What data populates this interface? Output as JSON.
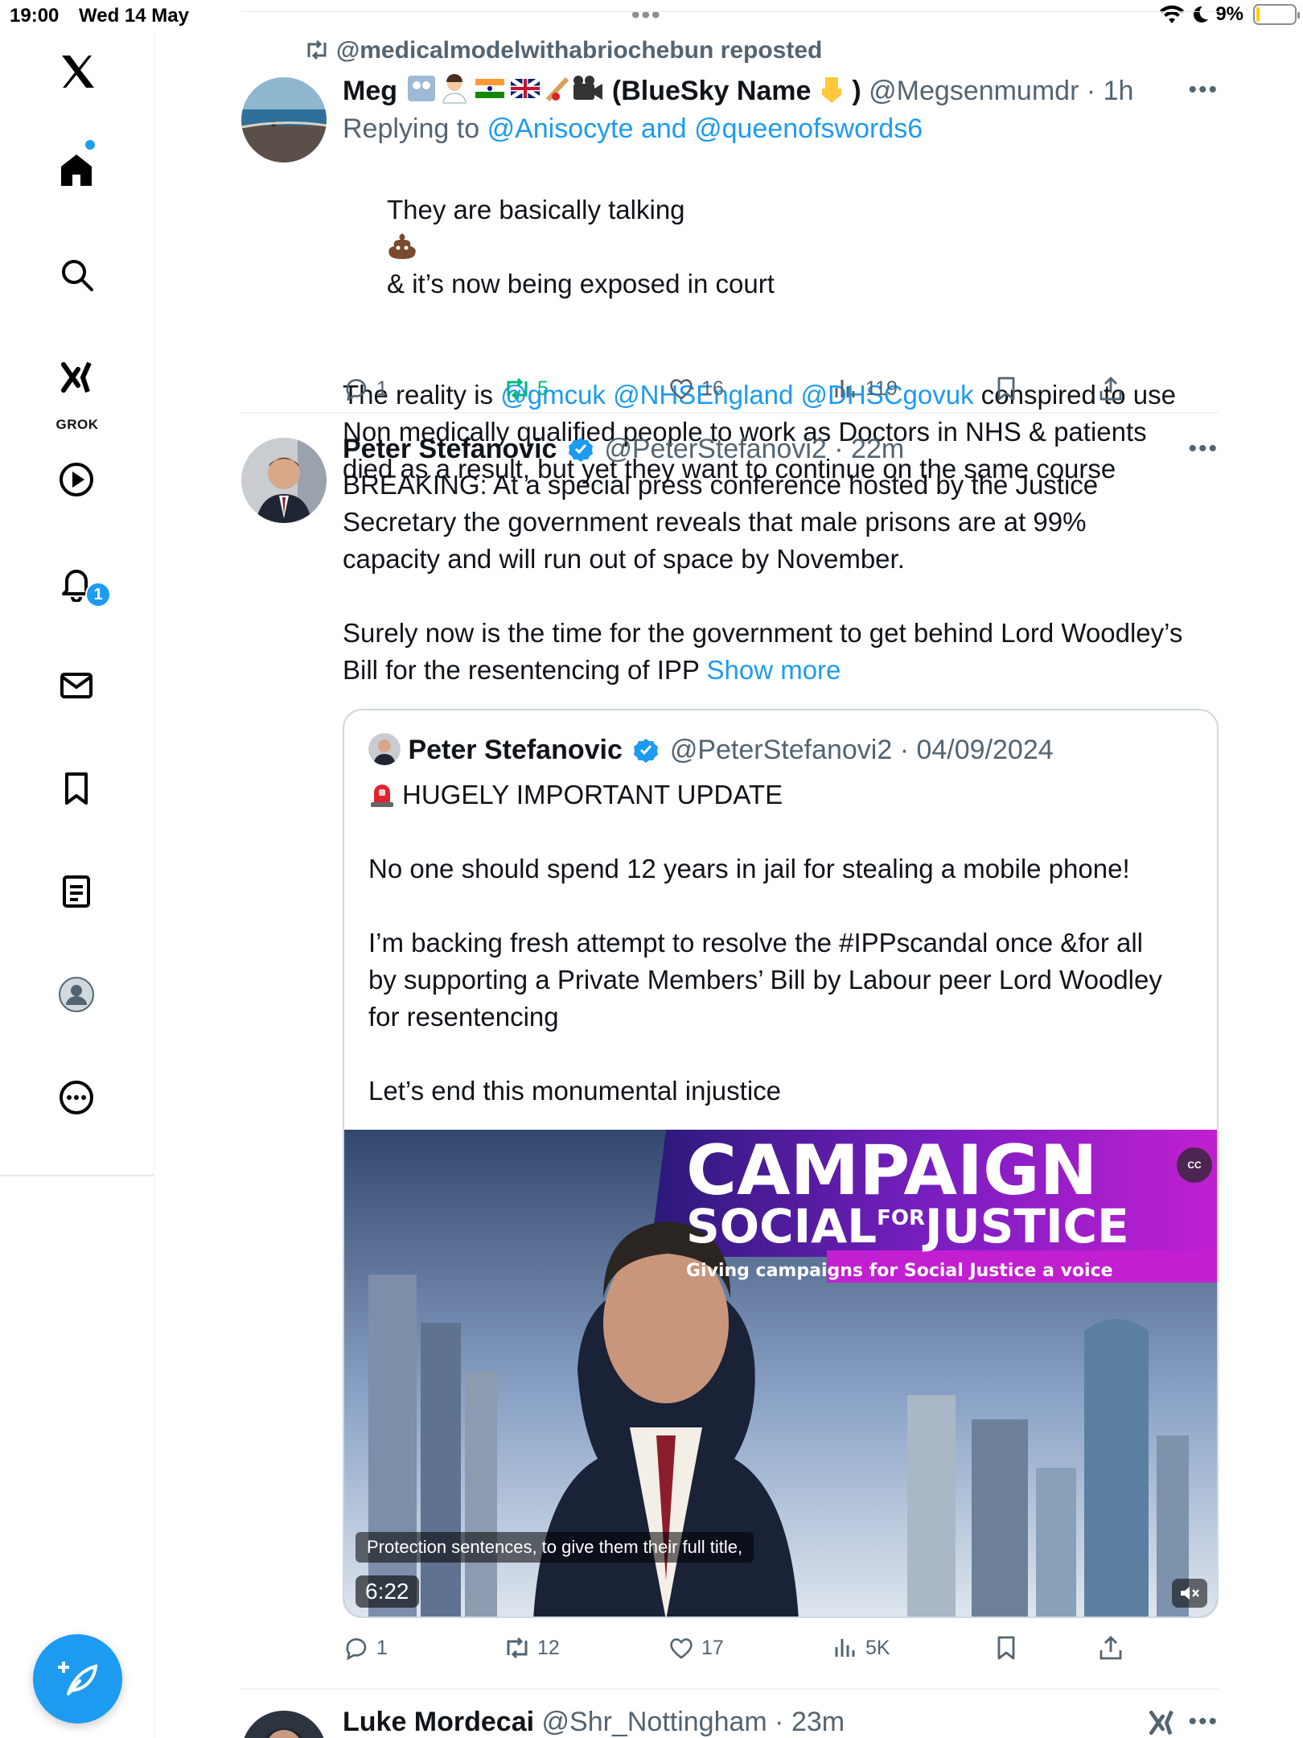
{
  "status_bar": {
    "time": "19:00",
    "date": "Wed 14 May",
    "battery": "9%",
    "battery_level": 0.09
  },
  "sidebar": {
    "items": [
      {
        "icon": "x-logo-icon"
      },
      {
        "icon": "home-icon"
      },
      {
        "icon": "search-icon"
      },
      {
        "icon": "grok-icon",
        "label": "GROK"
      },
      {
        "icon": "video-play-icon"
      },
      {
        "icon": "bell-icon",
        "badge": "1"
      },
      {
        "icon": "mail-icon"
      },
      {
        "icon": "bookmark-icon"
      },
      {
        "icon": "list-icon"
      },
      {
        "icon": "profile-icon"
      },
      {
        "icon": "more-circle-icon"
      }
    ]
  },
  "tweets": [
    {
      "repost_label": "@medicalmodelwithabriochebun reposted",
      "name": "Meg",
      "name_suffix": "(BlueSky Name",
      "name_close": ")",
      "handle": "@Megsenmumdr",
      "time": "1h",
      "replying_prefix": "Replying to",
      "replying_to": "@Anisocyte and @queenofswords6",
      "line1_a": "They are basically talking",
      "line1_b": "& it’s now being exposed in court",
      "line2_prefix": "The reality is",
      "line2_mentions": "@gmcuk @NHSEngland @DHSCgovuk",
      "line2_rest": " conspired to use",
      "line3": "Non medically qualified people to work as Doctors in NHS & patients\ndied as a result, but yet they want to continue on the same course",
      "stats": {
        "replies": "1",
        "reposts": "5",
        "likes": "16",
        "views": "119"
      }
    },
    {
      "name": "Peter Stefanovic",
      "handle": "@PeterStefanovi2",
      "time": "22m",
      "text": "BREAKING: At a special press conference hosted by the Justice\nSecretary the government reveals that male prisons are at 99%\ncapacity and will run out of space by November.\n\nSurely now is the time for the government to get behind Lord Woodley’s\nBill for the resentencing of IPP",
      "show_more": "Show more",
      "quote": {
        "name": "Peter Stefanovic",
        "handle": "@PeterStefanovi2",
        "date": "04/09/2024",
        "text": "HUGELY IMPORTANT UPDATE\n\nNo one should spend 12 years in jail for stealing a mobile phone!\n\nI’m backing fresh attempt to resolve the #IPPscandal once &for all\nby supporting a Private Members’ Bill by Labour peer Lord Woodley\nfor resentencing\n\nLet’s end this monumental injustice",
        "video": {
          "banner_line1": "CAMPAIGN",
          "banner_line2_a": "SOCIAL",
          "banner_line2_b": "FOR",
          "banner_line2_c": "JUSTICE",
          "banner_tagline": "Giving campaigns for Social Justice a voice",
          "caption": "Protection sentences, to give them their full title,",
          "duration": "6:22",
          "cc": "CC"
        }
      },
      "stats": {
        "replies": "1",
        "reposts": "12",
        "likes": "17",
        "views": "5K"
      }
    },
    {
      "name": "Luke Mordecai",
      "handle": "@Shr_Nottingham",
      "time": "23m"
    }
  ],
  "colors": {
    "accent": "#1d9bf0",
    "repost_green": "#00ba7c",
    "muted": "#536471",
    "banner_magenta": "#c41fd1",
    "banner_navy": "#1f2a6b"
  }
}
